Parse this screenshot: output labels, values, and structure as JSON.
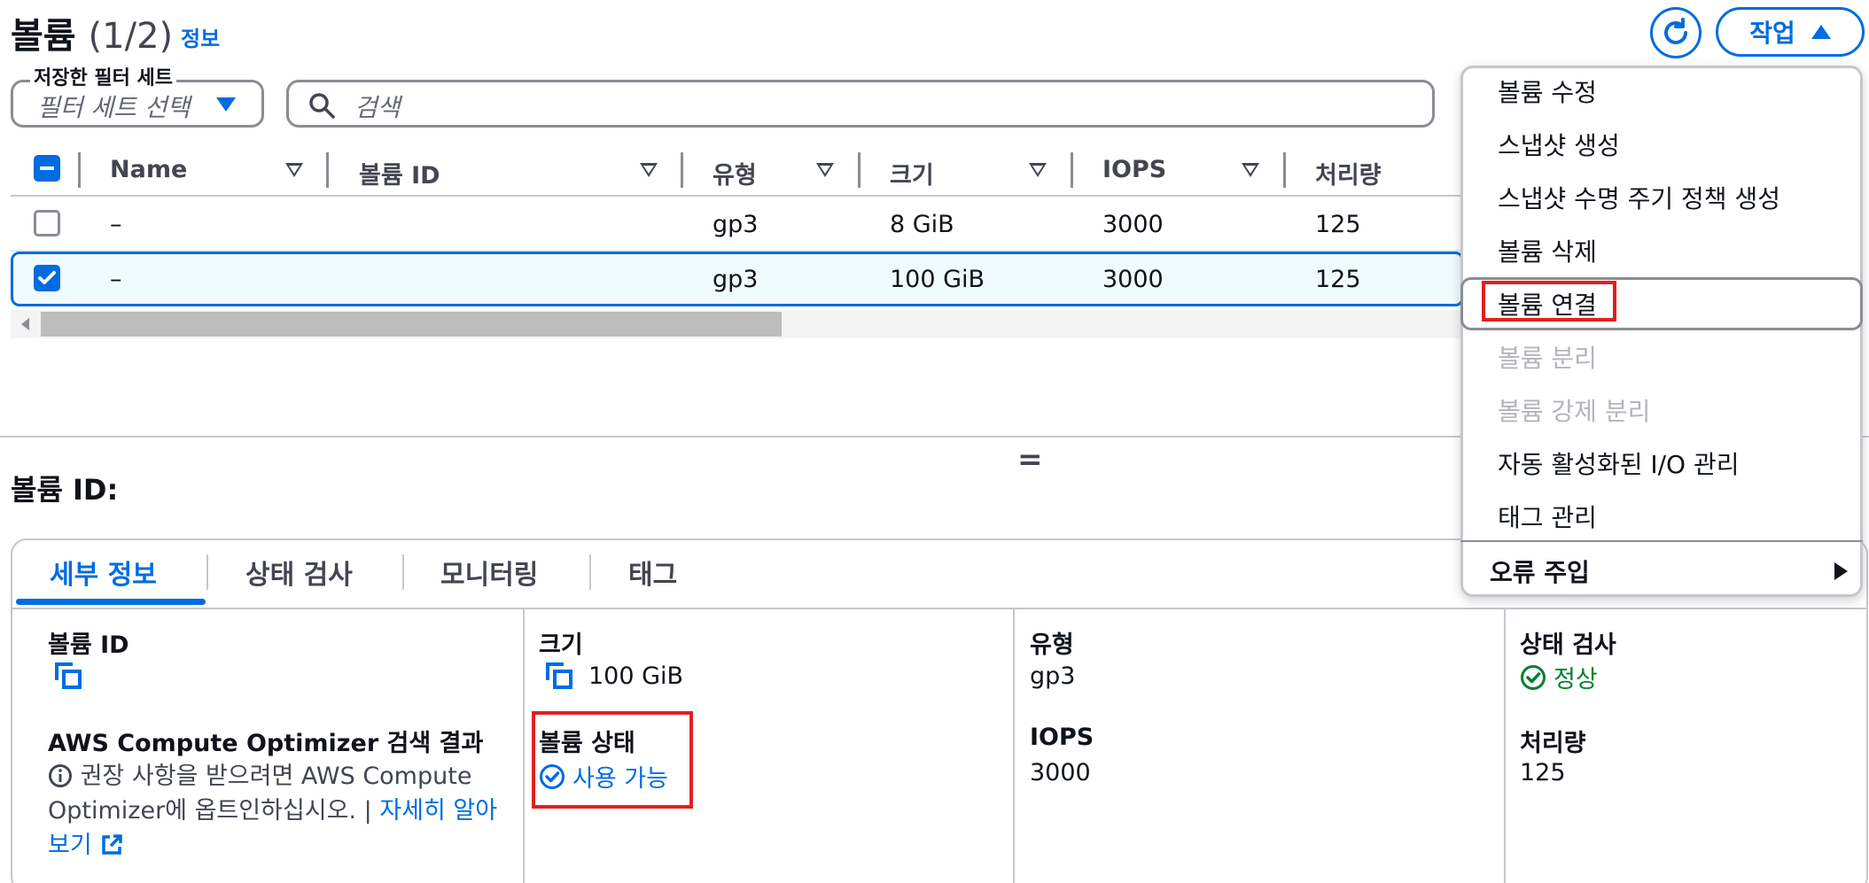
{
  "header": {
    "title": "볼륨",
    "count": "(1/2)",
    "info_link": "정보",
    "action_button": "작업"
  },
  "filters": {
    "saved_filter_label": "저장한 필터 세트",
    "saved_filter_placeholder": "필터 세트 선택",
    "search_placeholder": "검색"
  },
  "table": {
    "columns": [
      "Name",
      "볼륨 ID",
      "유형",
      "크기",
      "IOPS",
      "처리량"
    ],
    "rows": [
      {
        "name": "–",
        "volume_id": "",
        "type": "gp3",
        "size": "8 GiB",
        "iops": "3000",
        "throughput": "125",
        "selected": false
      },
      {
        "name": "–",
        "volume_id": "",
        "type": "gp3",
        "size": "100 GiB",
        "iops": "3000",
        "throughput": "125",
        "selected": true
      }
    ]
  },
  "details": {
    "title": "볼륨 ID:",
    "tabs": [
      "세부 정보",
      "상태 검사",
      "모니터링",
      "태그"
    ],
    "active_tab": "세부 정보",
    "volume_id_label": "볼륨 ID",
    "size_label": "크기",
    "size_value": "100 GiB",
    "type_label": "유형",
    "type_value": "gp3",
    "status_check_label": "상태 검사",
    "status_check_value": "정상",
    "optimizer_label": "AWS Compute Optimizer 검색 결과",
    "optimizer_text": "권장 사항을 받으려면 AWS Compute Optimizer에 옵트인하십시오. |",
    "optimizer_link": "자세히 알아보기",
    "volume_state_label": "볼륨 상태",
    "volume_state_value": "사용 가능",
    "iops_label": "IOPS",
    "iops_value": "3000",
    "throughput_label": "처리량",
    "throughput_value": "125"
  },
  "menu": {
    "items": [
      {
        "label": "볼륨 수정",
        "disabled": false
      },
      {
        "label": "스냅샷 생성",
        "disabled": false
      },
      {
        "label": "스냅샷 수명 주기 정책 생성",
        "disabled": false
      },
      {
        "label": "볼륨 삭제",
        "disabled": false
      },
      {
        "label": "볼륨 연결",
        "disabled": false,
        "highlighted": true
      },
      {
        "label": "볼륨 분리",
        "disabled": true
      },
      {
        "label": "볼륨 강제 분리",
        "disabled": true
      },
      {
        "label": "자동 활성화된 I/O 관리",
        "disabled": false
      },
      {
        "label": "태그 관리",
        "disabled": false
      }
    ],
    "submenu": "오류 주입"
  },
  "colors": {
    "accent": "#006ce0",
    "success": "#00802f",
    "annotation": "#e02020",
    "disabled": "#b4b4bb"
  },
  "icons": [
    "refresh-icon",
    "caret-up-icon",
    "caret-down-icon",
    "search-icon",
    "sort-icon",
    "copy-icon",
    "check-circle-icon",
    "info-icon",
    "external-link-icon",
    "caret-right-icon"
  ]
}
